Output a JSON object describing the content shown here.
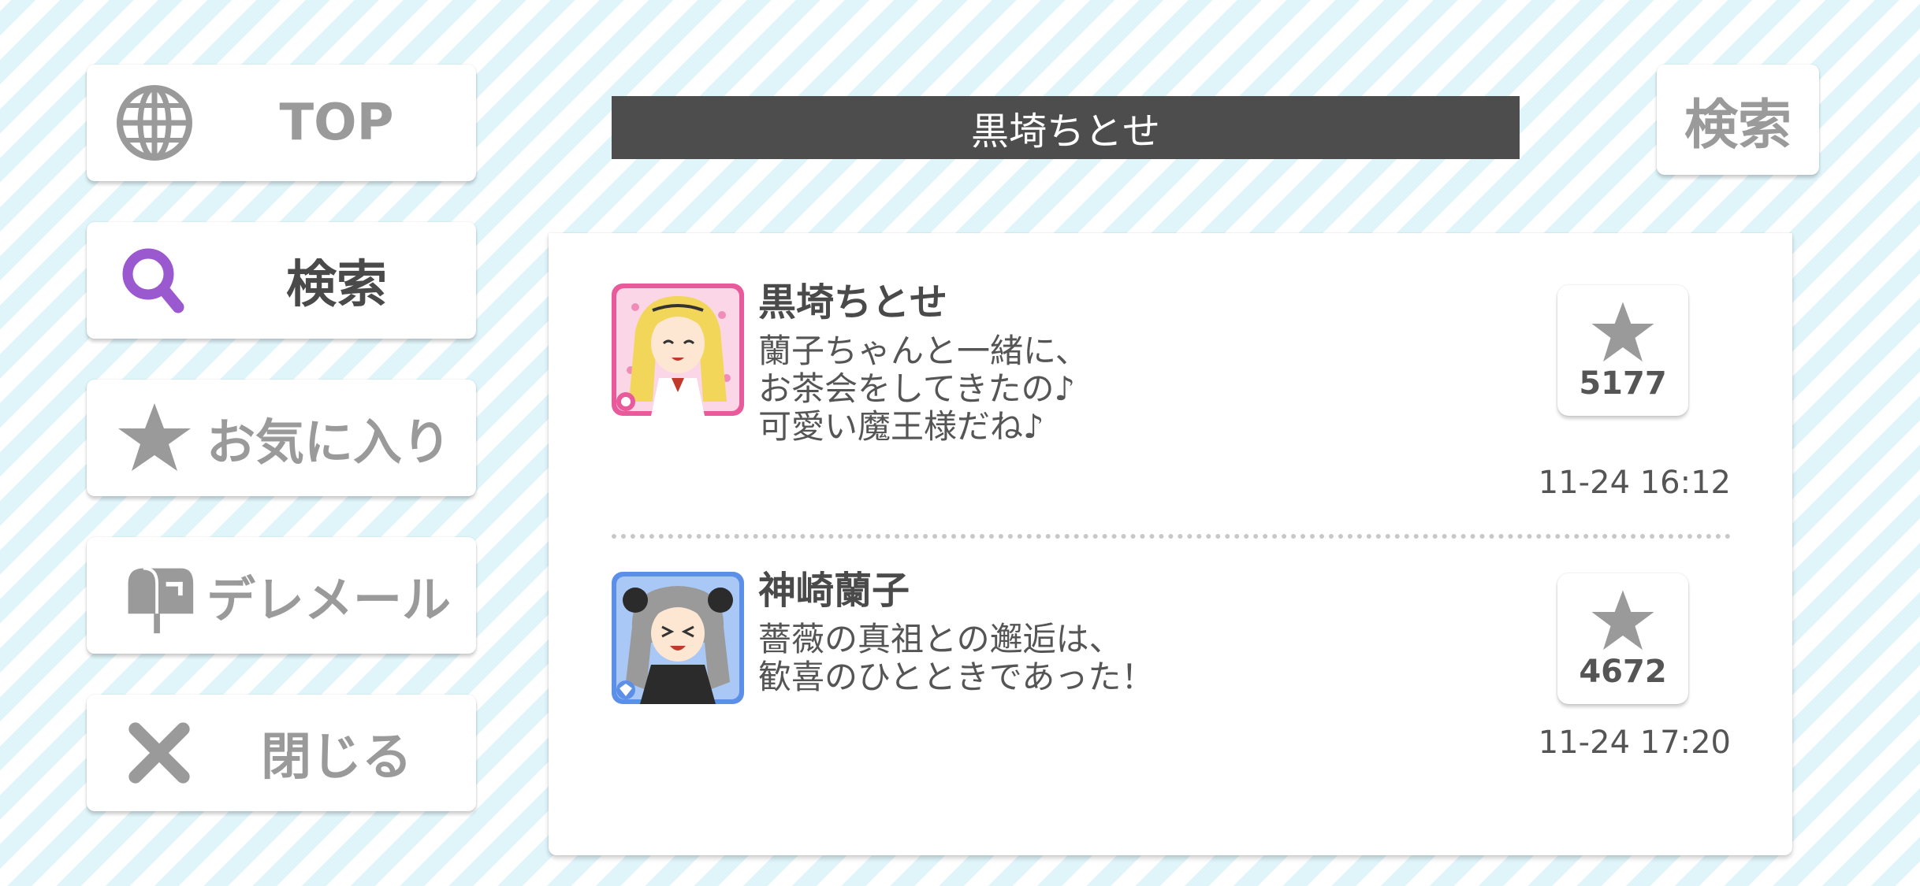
{
  "nav": {
    "top_label": "TOP",
    "search_label": "検索",
    "favorites_label": "お気に入り",
    "deremail_label": "デレメール",
    "close_label": "閉じる"
  },
  "header": {
    "title": "黒埼ちとせ",
    "search_button": "検索"
  },
  "posts": [
    {
      "name": "黒埼ちとせ",
      "message": "蘭子ちゃんと一緒に、\nお茶会をしてきたの♪\n可愛い魔王様だね♪",
      "likes": "5177",
      "time": "11-24 16:12"
    },
    {
      "name": "神崎蘭子",
      "message": "薔薇の真祖との邂逅は、\n歓喜のひとときであった！",
      "likes": "4672",
      "time": "11-24 17:20"
    }
  ],
  "colors": {
    "accent_purple": "#9b59d0",
    "button_gray": "#9a9a9a",
    "title_bar": "#4d4d4d",
    "card_pink": "#e85a9a",
    "card_blue": "#5b8fe8"
  },
  "icons": [
    "globe-icon",
    "search-icon",
    "star-icon",
    "mailbox-icon",
    "close-icon"
  ]
}
